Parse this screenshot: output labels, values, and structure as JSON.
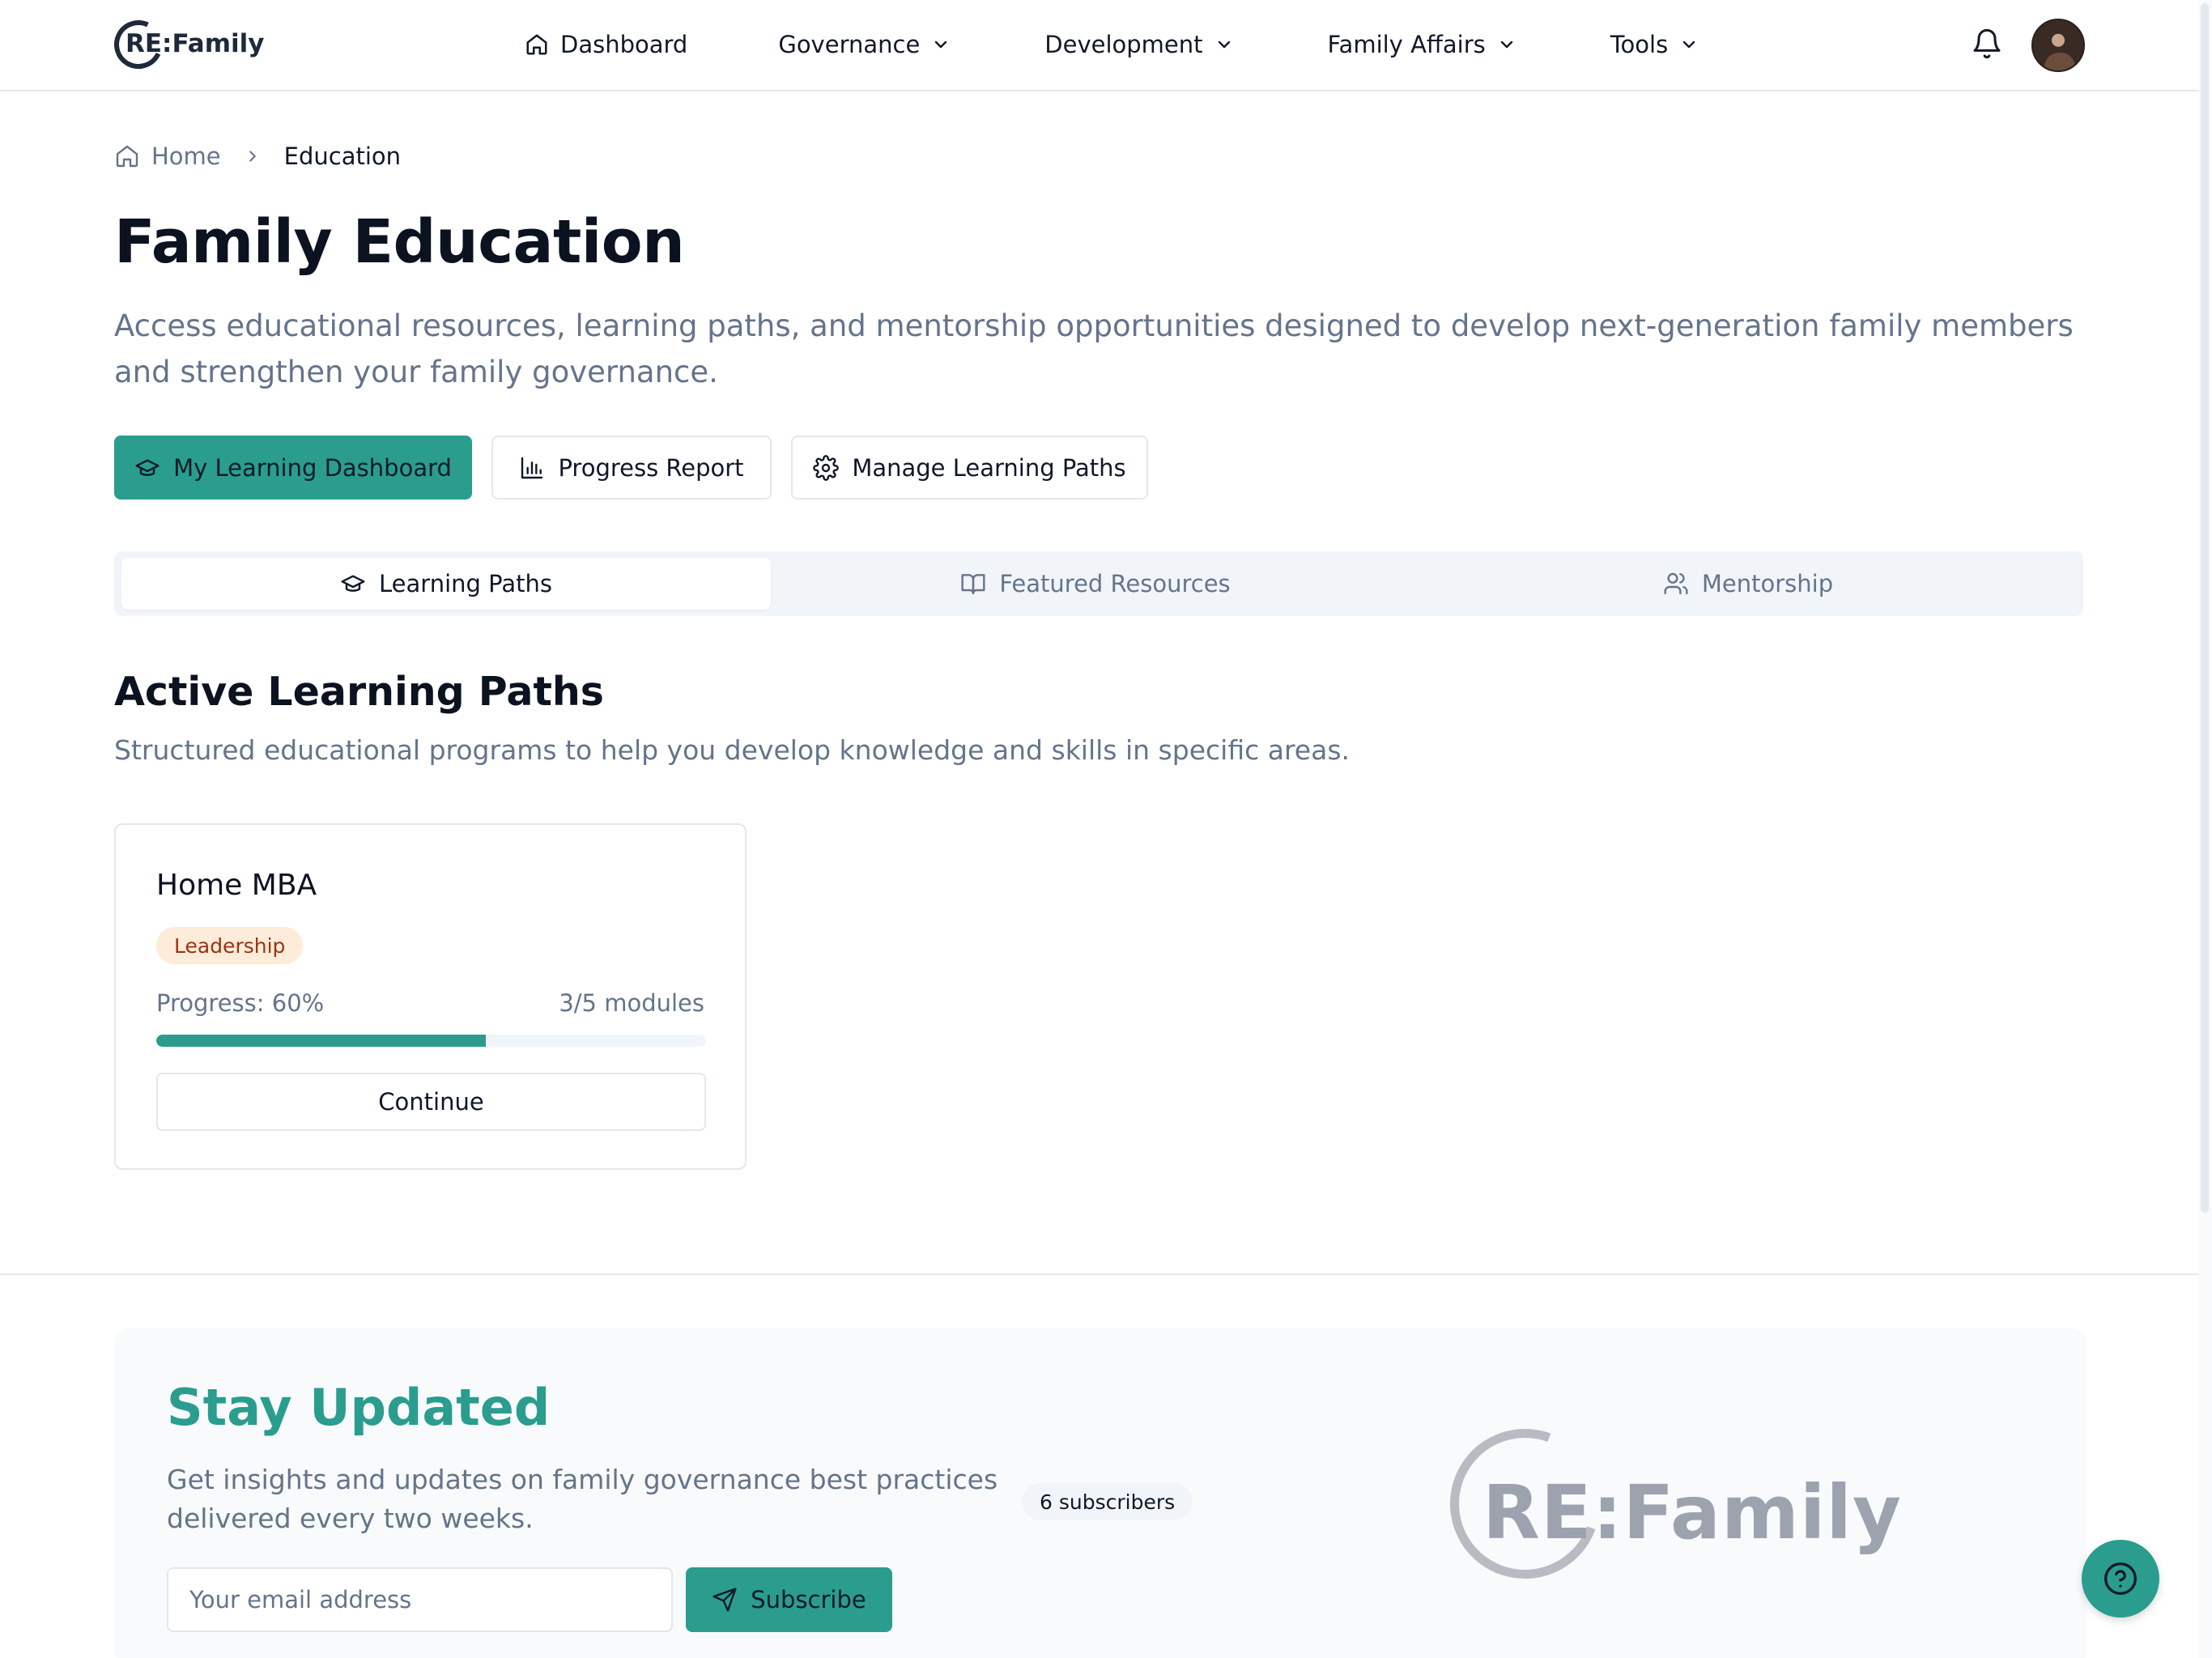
{
  "app": {
    "logo_text": "RE:Family"
  },
  "nav": {
    "items": [
      {
        "label": "Dashboard",
        "icon": "home-icon",
        "has_dropdown": false
      },
      {
        "label": "Governance",
        "icon": "",
        "has_dropdown": true
      },
      {
        "label": "Development",
        "icon": "",
        "has_dropdown": true
      },
      {
        "label": "Family Affairs",
        "icon": "",
        "has_dropdown": true
      },
      {
        "label": "Tools",
        "icon": "",
        "has_dropdown": true
      }
    ],
    "notifications_icon": "bell-icon"
  },
  "breadcrumb": {
    "home": "Home",
    "current": "Education"
  },
  "page": {
    "title": "Family Education",
    "description": "Access educational resources, learning paths, and mentorship opportunities designed to develop next-generation family members and strengthen your family governance."
  },
  "actions": {
    "dashboard_label": "My Learning Dashboard",
    "progress_label": "Progress Report",
    "manage_label": "Manage Learning Paths"
  },
  "tabs": [
    {
      "label": "Learning Paths",
      "icon": "graduation-cap-icon",
      "active": true
    },
    {
      "label": "Featured Resources",
      "icon": "book-open-icon",
      "active": false
    },
    {
      "label": "Mentorship",
      "icon": "users-icon",
      "active": false
    }
  ],
  "section": {
    "title": "Active Learning Paths",
    "description": "Structured educational programs to help you develop knowledge and skills in specific areas."
  },
  "learning_paths": [
    {
      "title": "Home MBA",
      "category": "Leadership",
      "progress_text": "Progress: 60%",
      "progress": 0.6,
      "modules_text": "3/5 modules",
      "button_label": "Continue"
    }
  ],
  "newsletter": {
    "title": "Stay Updated",
    "description": "Get insights and updates on family governance best practices delivered every two weeks.",
    "subscribers": "6 subscribers",
    "email_placeholder": "Your email address",
    "subscribe_label": "Subscribe",
    "logo_text": "RE:Family"
  },
  "colors": {
    "accent": "#2a9d8f",
    "badge_bg": "#fdecd9",
    "badge_text": "#9a3412",
    "muted_text": "#64748b"
  }
}
